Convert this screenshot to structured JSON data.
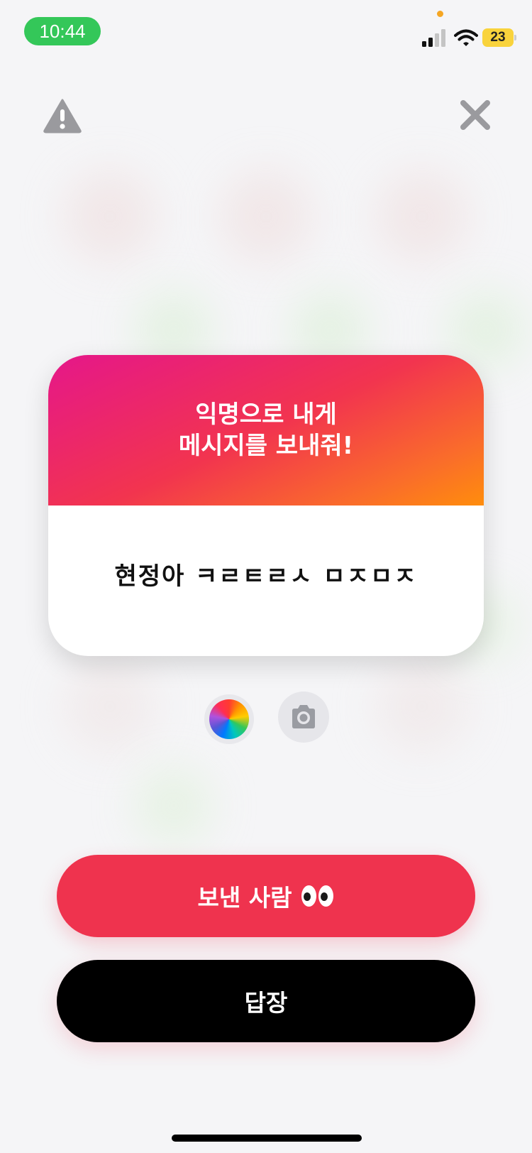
{
  "status_bar": {
    "time": "10:44",
    "battery_level": "23",
    "colors": {
      "time_pill": "#34c759",
      "battery": "#f9d33c"
    }
  },
  "top_controls": {
    "warning_icon": "warning-triangle-icon",
    "close_icon": "close-x-icon"
  },
  "card": {
    "title": "익명으로 내게\n메시지를 보내줘!",
    "message": "현정아 ㅋㄹㅌㄹㅅ ㅁㅈㅁㅈ",
    "gradient": [
      "#e5178a",
      "#f2344f",
      "#ff8d0c"
    ]
  },
  "tools": {
    "color_picker_icon": "color-wheel-icon",
    "camera_icon": "camera-icon"
  },
  "actions": {
    "sender_label": "보낸 사람",
    "sender_emoji_icon": "eyes-emoji-icon",
    "reply_label": "답장",
    "colors": {
      "sender": "#ef334e",
      "reply": "#000000"
    }
  }
}
